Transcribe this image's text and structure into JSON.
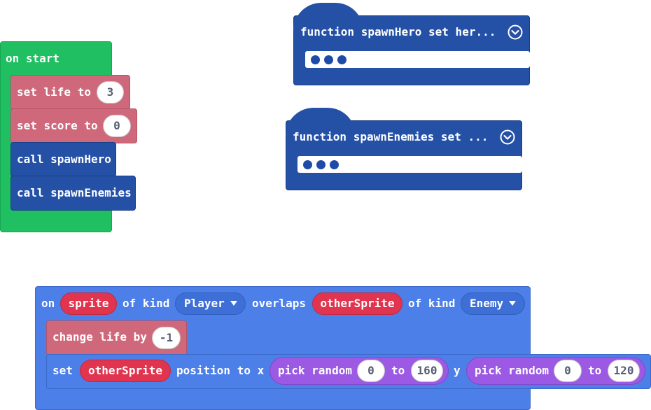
{
  "colors": {
    "events_green": "#1fbf62",
    "variables_red": "#d0687b",
    "functions_blue": "#2450a6",
    "sprites_blue": "#4c7fe8",
    "sprite_var_red": "#e0344f",
    "math_purple": "#9b59e4"
  },
  "on_start": {
    "hat_label": "on start",
    "set_life_label": "set life to",
    "set_life_value": "3",
    "set_score_label": "set score to",
    "set_score_value": "0",
    "call_hero_label": "call spawnHero",
    "call_enemies_label": "call spawnEnemies"
  },
  "function_hero": {
    "label": "function spawnHero  set her...",
    "icon": "chevron-circle-icon",
    "collapsed_icon": "ellipsis-dots"
  },
  "function_enemies": {
    "label": "function spawnEnemies  set ...",
    "icon": "chevron-circle-icon",
    "collapsed_icon": "ellipsis-dots"
  },
  "overlap_event": {
    "on_label": "on",
    "sprite_var": "sprite",
    "of_kind_1": "of kind",
    "kind_player": "Player",
    "overlaps_label": "overlaps",
    "other_sprite_var": "otherSprite",
    "of_kind_2": "of kind",
    "kind_enemy": "Enemy",
    "dropdown_icon": "triangle-down-icon",
    "change_life_label": "change life by",
    "change_life_value": "-1",
    "set_label": "set",
    "set_sprite_var": "otherSprite",
    "position_label": "position to x",
    "pick_random_1": "pick random",
    "rand_x_min": "0",
    "to_1": "to",
    "rand_x_max": "160",
    "y_label": "y",
    "pick_random_2": "pick random",
    "rand_y_min": "0",
    "to_2": "to",
    "rand_y_max": "120"
  }
}
